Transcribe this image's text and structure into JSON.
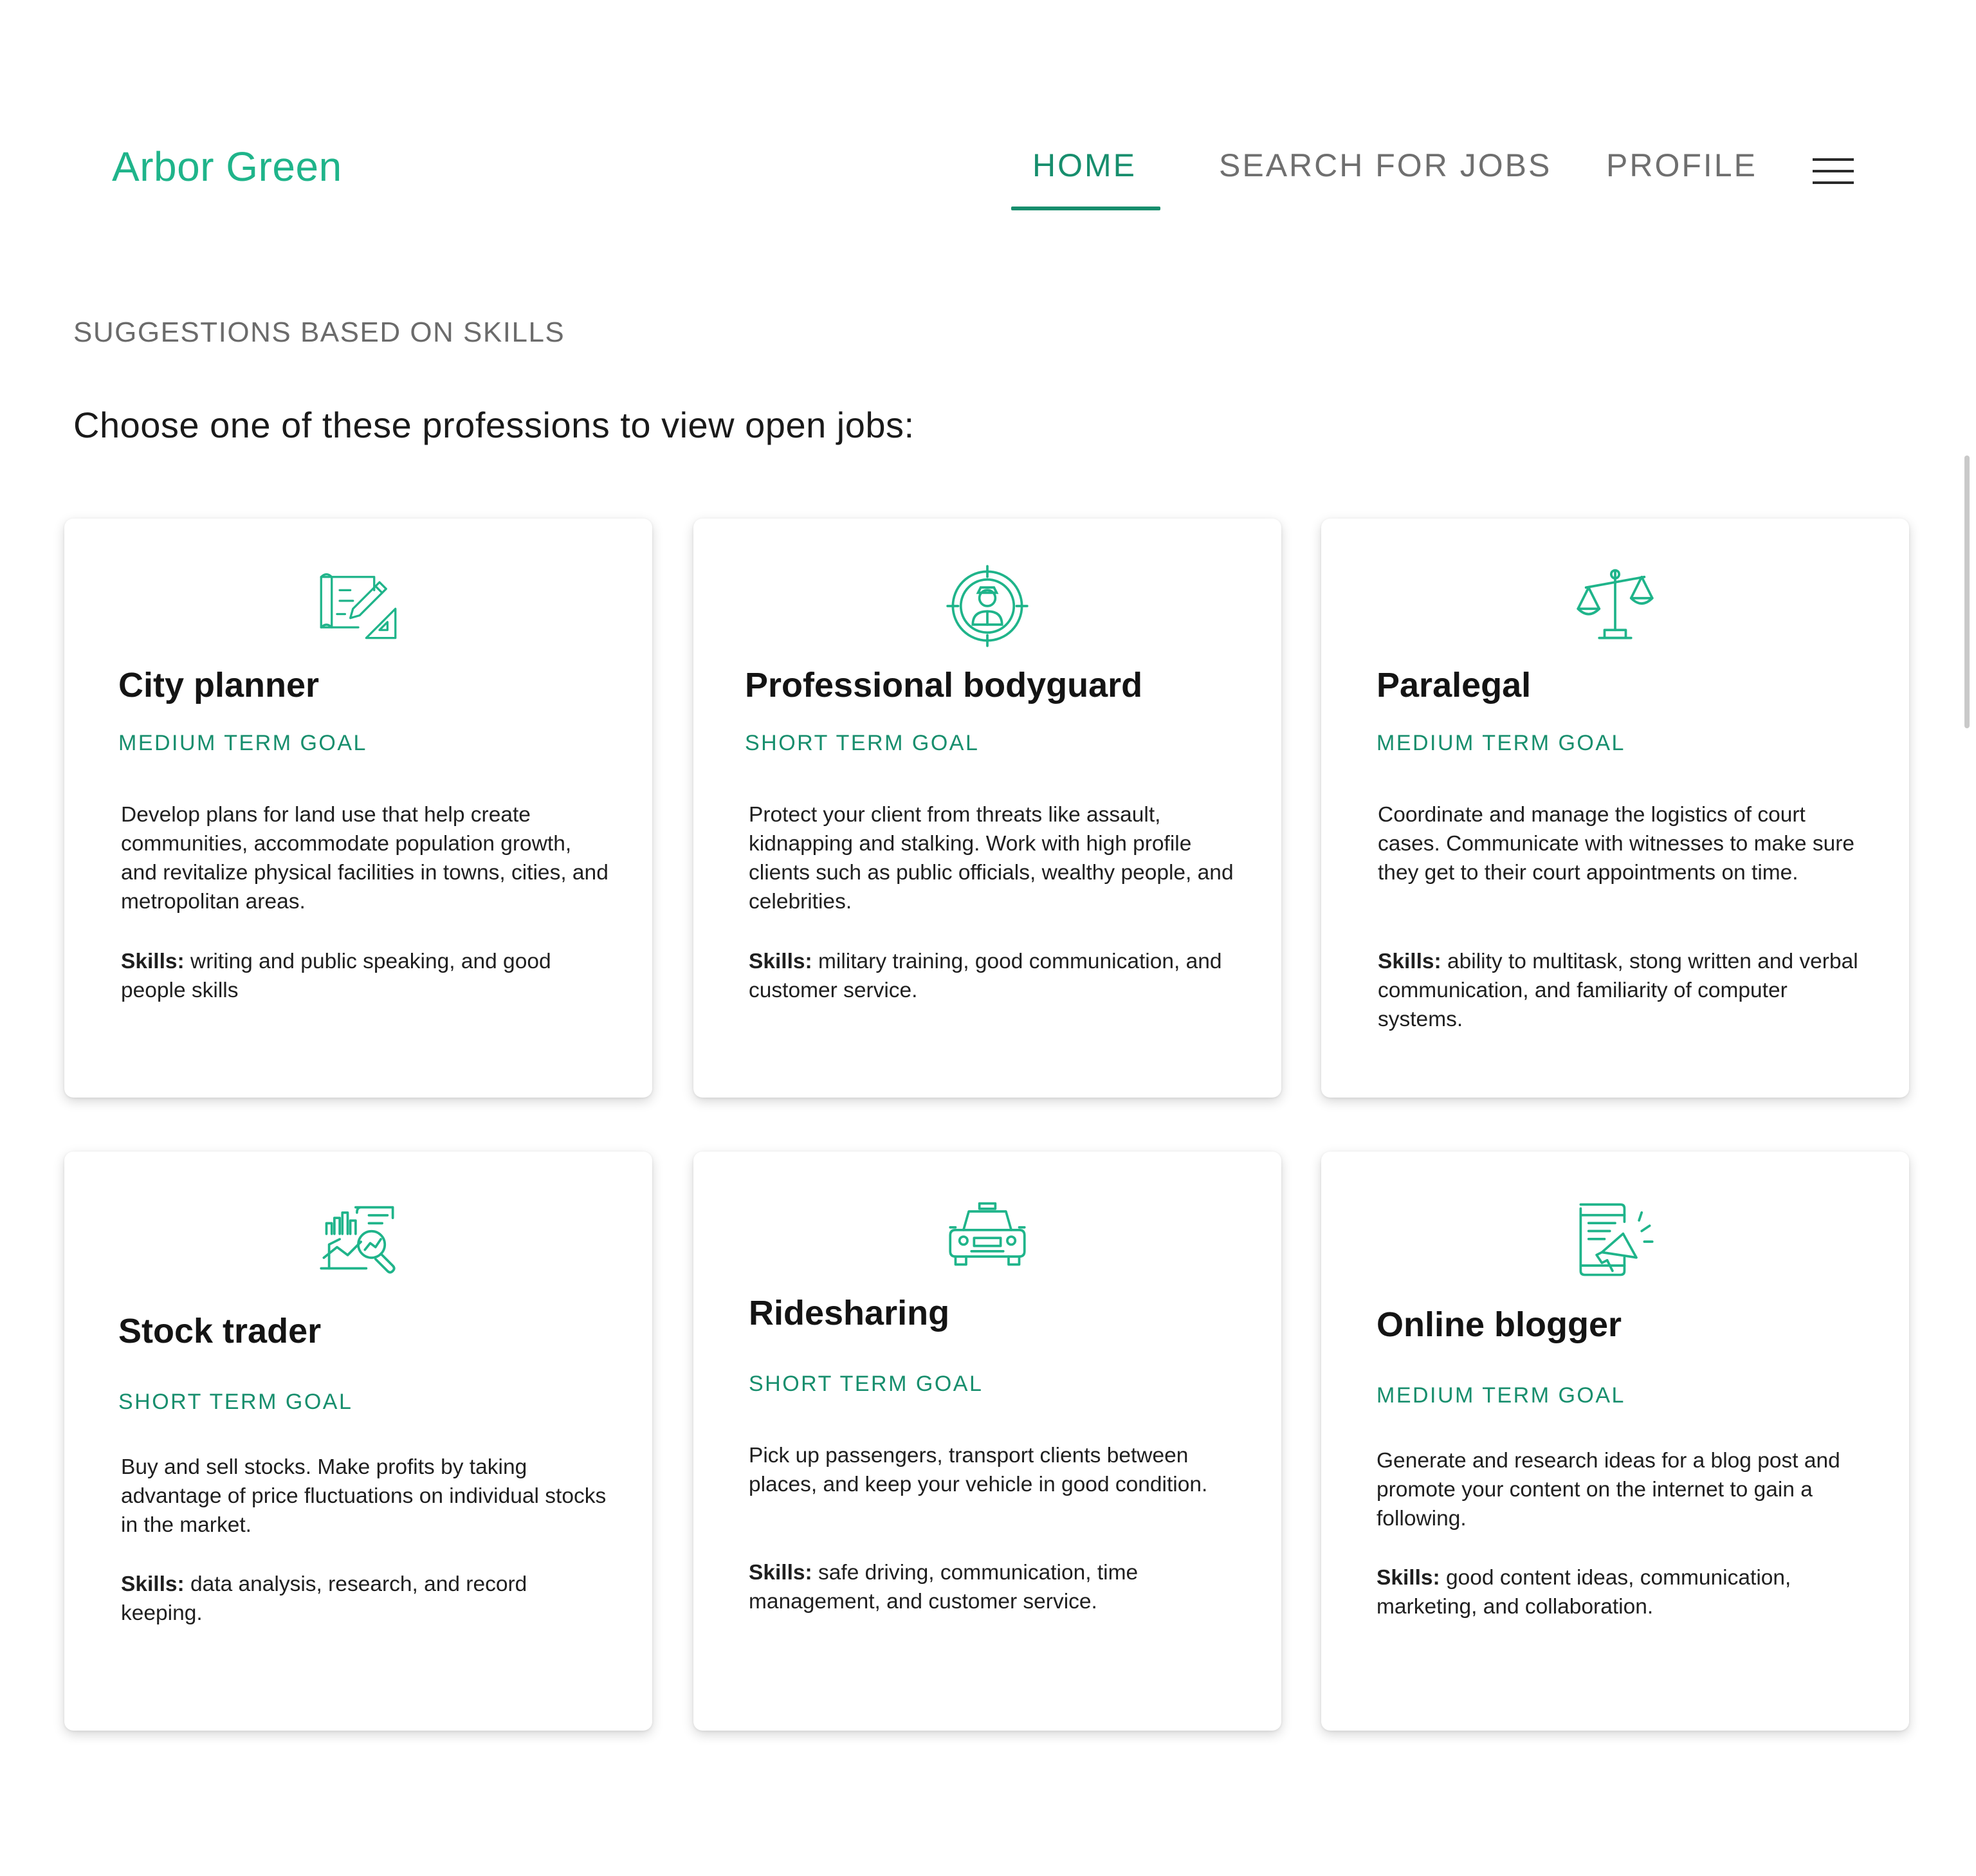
{
  "header": {
    "brand": "Arbor Green",
    "nav": [
      {
        "label": "HOME",
        "active": true
      },
      {
        "label": "SEARCH FOR JOBS",
        "active": false
      },
      {
        "label": "PROFILE",
        "active": false
      }
    ],
    "menu_icon": "hamburger-menu-icon"
  },
  "main": {
    "section_label": "SUGGESTIONS BASED ON SKILLS",
    "subtitle": "Choose one of these professions to view open jobs:"
  },
  "colors": {
    "accent": "#1fb48a",
    "accent_dark": "#178e6d"
  },
  "cards": [
    {
      "icon": "blueprint-pencil-icon",
      "title": "City planner",
      "goal": "MEDIUM TERM GOAL",
      "description": "Develop plans for land use that help create communities, accommodate population growth, and revitalize physical facilities in towns, cities, and metropolitan areas.",
      "skills_label": "Skills:",
      "skills": "writing and public speaking, and good people skills"
    },
    {
      "icon": "bodyguard-target-icon",
      "title": "Professional bodyguard",
      "goal": "SHORT TERM GOAL",
      "description": "Protect your client from threats like assault, kidnapping and stalking. Work with high profile clients such as public officials, wealthy people, and celebrities.",
      "skills_label": "Skills:",
      "skills": "military training, good communication, and customer service."
    },
    {
      "icon": "scales-of-justice-icon",
      "title": "Paralegal",
      "goal": "MEDIUM TERM GOAL",
      "description": "Coordinate and manage the logistics of court cases. Communicate with witnesses to make sure they get to their court appointments on time.",
      "skills_label": "Skills:",
      "skills": "ability to multitask, stong written and verbal communication, and familiarity of computer systems."
    },
    {
      "icon": "stock-analysis-icon",
      "title": "Stock trader",
      "goal": "SHORT TERM GOAL",
      "description": "Buy and sell stocks. Make profits by taking advantage of price fluctuations on individual stocks in the market.",
      "skills_label": "Skills:",
      "skills": "data analysis, research, and record keeping."
    },
    {
      "icon": "taxi-car-icon",
      "title": "Ridesharing",
      "goal": "SHORT TERM GOAL",
      "description": "Pick up passengers, transport clients between places, and keep your vehicle in good condition.",
      "skills_label": "Skills:",
      "skills": "safe driving, communication, time management, and customer service."
    },
    {
      "icon": "phone-megaphone-icon",
      "title": "Online blogger",
      "goal": "MEDIUM TERM GOAL",
      "description": "Generate and research ideas for a blog post and promote your content on the internet to gain a following.",
      "skills_label": "Skills:",
      "skills": "good content ideas, communication, marketing, and collaboration."
    }
  ]
}
